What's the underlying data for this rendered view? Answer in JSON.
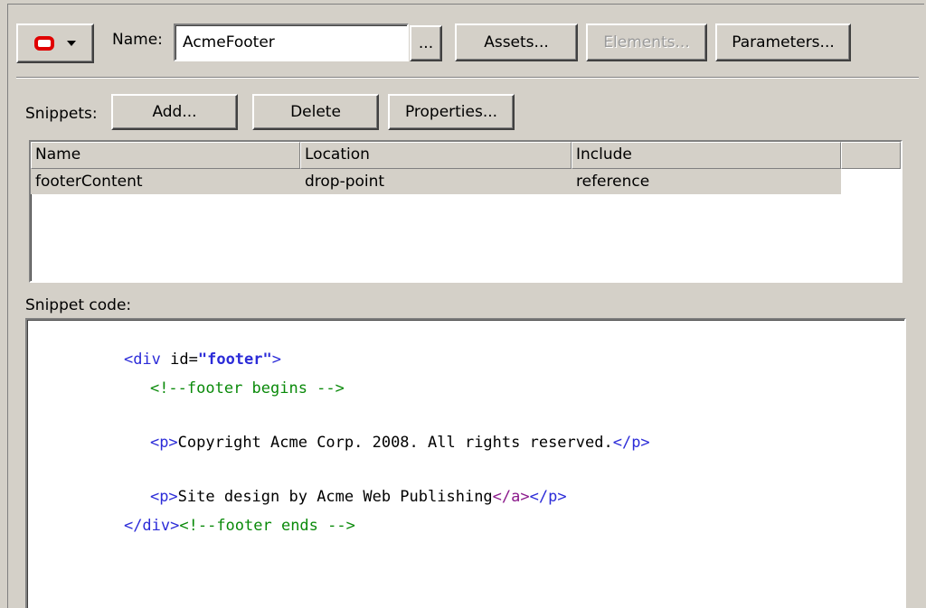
{
  "toolbar": {
    "menu_icon": "oracle-logo-icon",
    "dropdown_icon": "chevron-down-icon",
    "name_label": "Name:",
    "name_value": "AcmeFooter",
    "browse_label": "...",
    "assets_label": "Assets...",
    "elements_label": "Elements...",
    "parameters_label": "Parameters..."
  },
  "snippets": {
    "label": "Snippets:",
    "add_label": "Add...",
    "delete_label": "Delete",
    "properties_label": "Properties...",
    "columns": [
      "Name",
      "Location",
      "Include"
    ],
    "rows": [
      {
        "name": "footerContent",
        "location": "drop-point",
        "include": "reference"
      }
    ]
  },
  "code": {
    "label": "Snippet code:",
    "line1": {
      "open": "<div",
      "attr": " id=",
      "val": "\"footer\"",
      "close": ">"
    },
    "line2": {
      "comment": "<!--footer begins -->"
    },
    "line3": {
      "open": "<p>",
      "text": "Copyright Acme Corp. 2008. All rights reserved.",
      "close": "</p>"
    },
    "line4": {
      "open": "<p>",
      "text": "Site design by Acme Web Publishing",
      "anchor_close": "</a>",
      "close": "</p>"
    },
    "line5": {
      "close": "</div>",
      "comment": "<!--footer ends -->"
    }
  },
  "colors": {
    "dialog_bg": "#d4d0c8",
    "tag": "#2b2bd8",
    "comment": "#0a8a0a",
    "anchor": "#8b1a8b",
    "icon_red": "#e00000"
  }
}
